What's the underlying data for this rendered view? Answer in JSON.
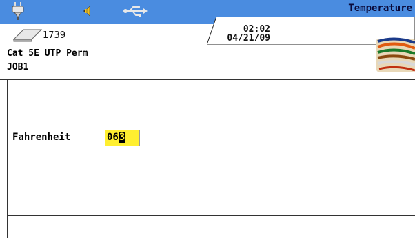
{
  "header": {
    "title": "Temperature",
    "time": "02:02",
    "date": "04/21/09",
    "count": "1739"
  },
  "job": {
    "cable_type": "Cat 5E UTP Perm",
    "job_name": "JOB1"
  },
  "setting": {
    "label": "Fahrenheit",
    "value_prefix": "06",
    "value_cursor": "3"
  },
  "icons": [
    "power-plug-icon",
    "speaker-icon",
    "usb-icon",
    "memory-card-icon",
    "cable-bundle-icon"
  ],
  "colors": {
    "header": "#4a8ce0",
    "field": "#ffef30"
  }
}
